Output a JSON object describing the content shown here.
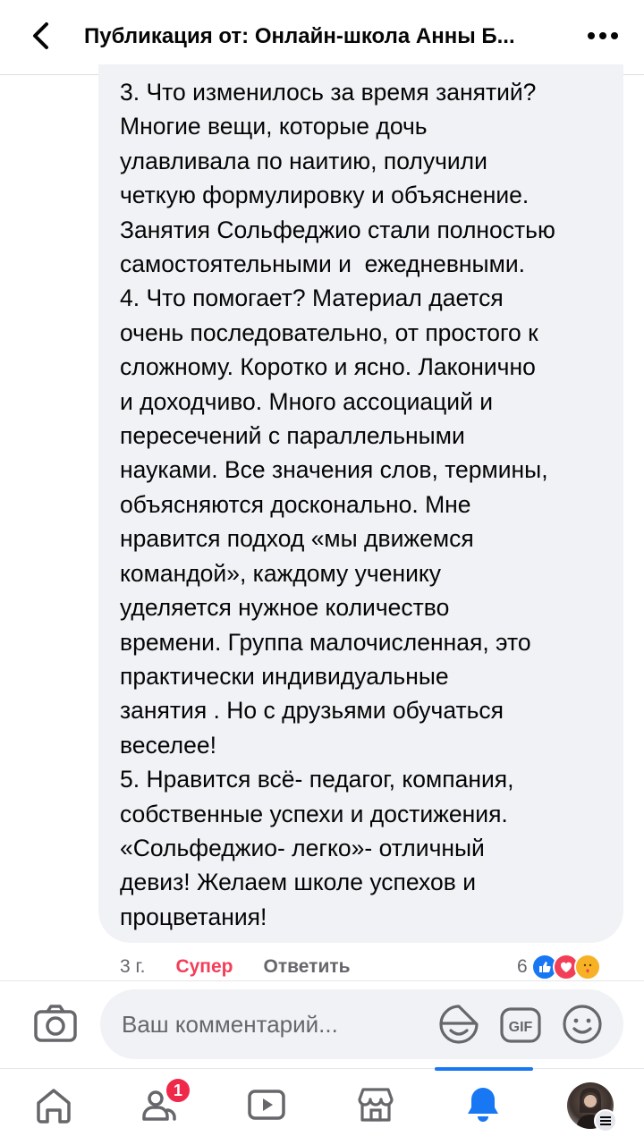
{
  "header": {
    "title": "Публикация от: Онлайн-школа Анны Б..."
  },
  "comment": {
    "text": "3. Что изменилось за время занятий?\nМногие вещи, которые дочь\nулавливала по наитию, получили\nчеткую формулировку и объяснение.\nЗанятия Сольфеджио стали полностью\nсамостоятельными и  ежедневными.\n4. Что помогает? Материал дается\nочень последовательно, от простого к\nсложному. Коротко и ясно. Лаконично\nи доходчиво. Много ассоциаций и\nпересечений с параллельными\nнауками. Все значения слов, термины,\nобъясняются досконально. Мне\nнравится подход «мы движемся\nкомандой», каждому ученику\nуделяется нужное количество\nвремени. Группа малочисленная, это\nпрактически индивидуальные\nзанятия . Но с друзьями обучаться\nвеселее!\n5. Нравится всё- педагог, компания,\nсобственные успехи и достижения.\n«Сольфеджио- легко»- отличный\nдевиз! Желаем школе успехов и\nпроцветания!",
    "time": "3 г.",
    "reaction_label": "Супер",
    "reply_label": "Ответить",
    "reaction_count": "6",
    "reaction_icons": [
      "like-icon",
      "love-icon",
      "care-icon"
    ]
  },
  "composer": {
    "placeholder": "Ваш комментарий..."
  },
  "tabbar": {
    "icons": [
      "home-icon",
      "friends-icon",
      "watch-icon",
      "marketplace-icon",
      "notifications-icon",
      "profile-avatar"
    ],
    "active": "notifications-icon",
    "friends_badge": "1"
  },
  "colors": {
    "accent": "#1877f2",
    "super_reaction": "#f33e58",
    "badge": "#f02849",
    "bubble": "#f0f2f5"
  }
}
